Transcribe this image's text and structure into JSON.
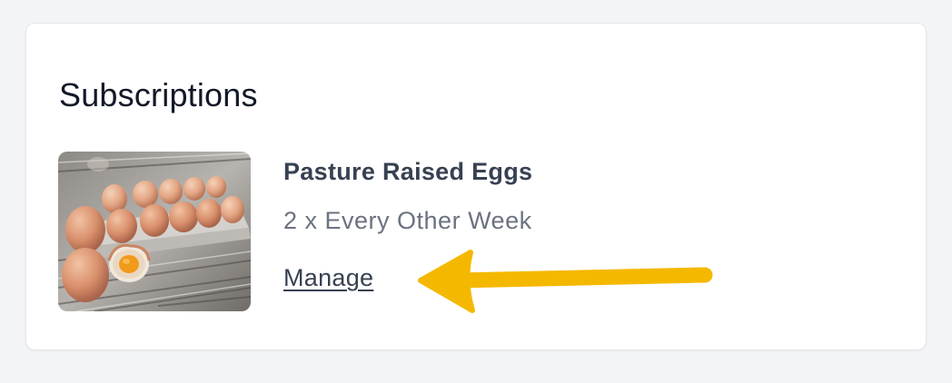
{
  "section": {
    "title": "Subscriptions"
  },
  "subscription": {
    "product_name": "Pasture Raised Eggs",
    "frequency": "2 x Every Other Week",
    "manage_label": "Manage",
    "image_icon": "eggs-photo"
  },
  "annotation": {
    "arrow_color": "#f5b800",
    "arrow_direction": "left"
  },
  "colors": {
    "page_bg": "#f3f4f6",
    "card_bg": "#ffffff",
    "title": "#111827",
    "product": "#374151",
    "muted": "#6b7280"
  }
}
